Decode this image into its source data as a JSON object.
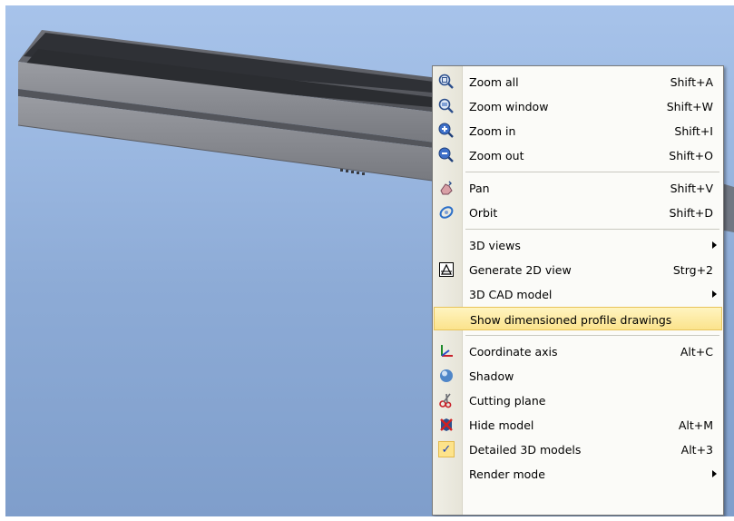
{
  "colors": {
    "viewport_background": "#9cb9e2",
    "menu_background": "#fbfbf8",
    "highlight": "#fbe38c",
    "profile_body": "#7c7e84",
    "profile_top": "#3a3c42"
  },
  "context_menu": {
    "groups": [
      {
        "items": [
          {
            "label": "Zoom all",
            "shortcut": "Shift+A",
            "icon": "zoom-all-icon"
          },
          {
            "label": "Zoom window",
            "shortcut": "Shift+W",
            "icon": "zoom-window-icon"
          },
          {
            "label": "Zoom in",
            "shortcut": "Shift+I",
            "icon": "zoom-in-icon"
          },
          {
            "label": "Zoom out",
            "shortcut": "Shift+O",
            "icon": "zoom-out-icon"
          }
        ]
      },
      {
        "items": [
          {
            "label": "Pan",
            "shortcut": "Shift+V",
            "icon": "pan-hand-icon"
          },
          {
            "label": "Orbit",
            "shortcut": "Shift+D",
            "icon": "orbit-icon"
          }
        ]
      },
      {
        "items": [
          {
            "label": "3D views",
            "shortcut": "",
            "submenu": true
          },
          {
            "label": "Generate 2D view",
            "shortcut": "Strg+2",
            "icon": "generate-2d-view-icon"
          },
          {
            "label": "3D CAD model",
            "shortcut": "",
            "submenu": true
          },
          {
            "label": "Show dimensioned profile drawings",
            "shortcut": "",
            "highlighted": true
          }
        ]
      },
      {
        "items": [
          {
            "label": "Coordinate axis",
            "shortcut": "Alt+C",
            "icon": "coordinate-axis-icon"
          },
          {
            "label": "Shadow",
            "shortcut": "",
            "icon": "shadow-icon"
          },
          {
            "label": "Cutting plane",
            "shortcut": "",
            "icon": "scissors-icon"
          },
          {
            "label": "Hide model",
            "shortcut": "Alt+M",
            "icon": "hide-model-icon"
          },
          {
            "label": "Detailed 3D models",
            "shortcut": "Alt+3",
            "icon": "check-icon",
            "checked": true
          },
          {
            "label": "Render mode",
            "shortcut": "",
            "submenu": true
          }
        ]
      }
    ]
  }
}
